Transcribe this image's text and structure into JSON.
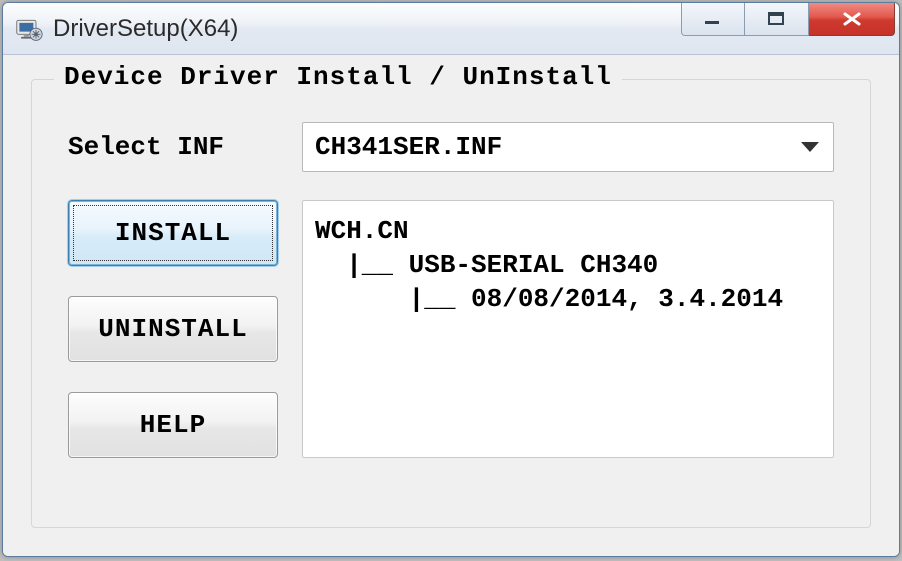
{
  "window": {
    "title": "DriverSetup(X64)"
  },
  "group": {
    "title": "Device Driver Install / UnInstall",
    "select_label": "Select INF",
    "selected_inf": "CH341SER.INF"
  },
  "buttons": {
    "install": "INSTALL",
    "uninstall": "UNINSTALL",
    "help": "HELP"
  },
  "info": {
    "line1": "WCH.CN",
    "line2": "  |__ USB-SERIAL CH340",
    "line3": "      |__ 08/08/2014, 3.4.2014"
  }
}
